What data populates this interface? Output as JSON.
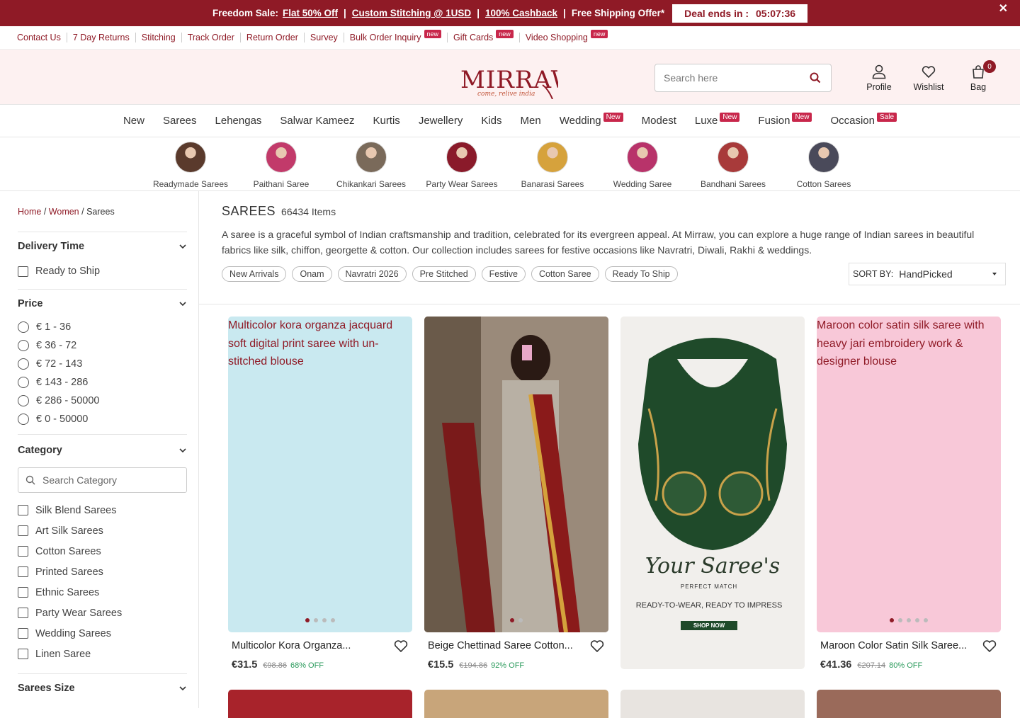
{
  "promo": {
    "lead": "Freedom Sale:",
    "offer1": "Flat 50% Off",
    "offer2": "Custom Stitching @ 1USD",
    "offer3": "100% Cashback",
    "offer4": "Free Shipping Offer*",
    "deal_label": "Deal ends in :",
    "deal_time": "05:07:36",
    "close": "✕"
  },
  "util_links": [
    {
      "label": "Contact Us",
      "tag": ""
    },
    {
      "label": "7 Day Returns",
      "tag": ""
    },
    {
      "label": "Stitching",
      "tag": ""
    },
    {
      "label": "Track Order",
      "tag": ""
    },
    {
      "label": "Return Order",
      "tag": ""
    },
    {
      "label": "Survey",
      "tag": ""
    },
    {
      "label": "Bulk Order Inquiry",
      "tag": "new"
    },
    {
      "label": "Gift Cards",
      "tag": "new"
    },
    {
      "label": "Video Shopping",
      "tag": "new"
    }
  ],
  "brand": {
    "name": "MIRRAW",
    "tagline": "come, relive india"
  },
  "search": {
    "placeholder": "Search here"
  },
  "header_icons": {
    "profile": "Profile",
    "wishlist": "Wishlist",
    "bag": "Bag",
    "bag_count": "0"
  },
  "nav": [
    {
      "label": "New",
      "tag": ""
    },
    {
      "label": "Sarees",
      "tag": ""
    },
    {
      "label": "Lehengas",
      "tag": ""
    },
    {
      "label": "Salwar Kameez",
      "tag": ""
    },
    {
      "label": "Kurtis",
      "tag": ""
    },
    {
      "label": "Jewellery",
      "tag": ""
    },
    {
      "label": "Kids",
      "tag": ""
    },
    {
      "label": "Men",
      "tag": ""
    },
    {
      "label": "Wedding",
      "tag": "New"
    },
    {
      "label": "Modest",
      "tag": ""
    },
    {
      "label": "Luxe",
      "tag": "New"
    },
    {
      "label": "Fusion",
      "tag": "New"
    },
    {
      "label": "Occasion",
      "tag": "Sale"
    }
  ],
  "categories": [
    {
      "label": "Readymade Sarees",
      "color": "#5a3a2c"
    },
    {
      "label": "Paithani Saree",
      "color": "#c23a6a"
    },
    {
      "label": "Chikankari Sarees",
      "color": "#7a6a5a"
    },
    {
      "label": "Party Wear Sarees",
      "color": "#8a1a2a"
    },
    {
      "label": "Banarasi Sarees",
      "color": "#d6a23c"
    },
    {
      "label": "Wedding Saree",
      "color": "#b8336a"
    },
    {
      "label": "Bandhani Sarees",
      "color": "#a83a3a"
    },
    {
      "label": "Cotton Sarees",
      "color": "#4a4a5a"
    }
  ],
  "breadcrumb": {
    "home": "Home",
    "women": "Women",
    "current": "Sarees",
    "sep": "/"
  },
  "filters": {
    "delivery": {
      "title": "Delivery Time",
      "options": [
        "Ready to Ship"
      ]
    },
    "price": {
      "title": "Price",
      "options": [
        "€ 1 - 36",
        "€ 36 - 72",
        "€ 72 - 143",
        "€ 143 - 286",
        "€ 286 - 50000",
        "€ 0 - 50000"
      ]
    },
    "category": {
      "title": "Category",
      "search_placeholder": "Search Category",
      "options": [
        "Silk Blend Sarees",
        "Art Silk Sarees",
        "Cotton Sarees",
        "Printed Sarees",
        "Ethnic Sarees",
        "Party Wear Sarees",
        "Wedding Sarees",
        "Linen Saree"
      ]
    },
    "size": {
      "title": "Sarees Size"
    }
  },
  "listing": {
    "title": "SAREES",
    "count": "66434 Items",
    "description": "A saree is a graceful symbol of Indian craftsmanship and tradition, celebrated for its evergreen appeal. At Mirraw, you can explore a huge range of Indian sarees in beautiful fabrics like silk, chiffon, georgette & cotton. Our collection includes sarees for festive occasions like Navratri, Diwali, Rakhi & weddings.",
    "chips": [
      "New Arrivals",
      "Onam",
      "Navratri 2026",
      "Pre Stitched",
      "Festive",
      "Cotton Saree",
      "Ready To Ship"
    ],
    "sort_label": "SORT BY:",
    "sort_value": "HandPicked"
  },
  "products": [
    {
      "alt": "Multicolor kora organza jacquard soft digital print saree with un-stitched blouse",
      "name": "Multicolor Kora Organza...",
      "price": "€31.5",
      "was": "€98.86",
      "off": "68% OFF",
      "bg": "#c9e9f0",
      "dots": 4
    },
    {
      "alt": "",
      "name": "Beige Chettinad Saree Cotton...",
      "price": "€15.5",
      "was": "€194.86",
      "off": "92% OFF",
      "bg": "#8a7a6a",
      "dots": 2
    },
    {
      "alt": "",
      "name": "",
      "price": "",
      "was": "",
      "off": "",
      "bg": "#f1efec",
      "dots": 0,
      "promo_script": "Your Saree's",
      "promo_sub": "PERFECT MATCH",
      "promo_line": "READY-TO-WEAR, READY TO IMPRESS",
      "promo_cta": "SHOP NOW"
    },
    {
      "alt": "Maroon color satin silk saree with heavy jari embroidery work & designer blouse",
      "name": "Maroon Color Satin Silk Saree...",
      "price": "€41.36",
      "was": "€207.14",
      "off": "80% OFF",
      "bg": "#f8c8d8",
      "dots": 5
    }
  ],
  "colors": {
    "brand": "#8f1a26",
    "tag": "#c8274b",
    "header_bg": "#fdf1f1",
    "discount": "#2a9a5b"
  }
}
